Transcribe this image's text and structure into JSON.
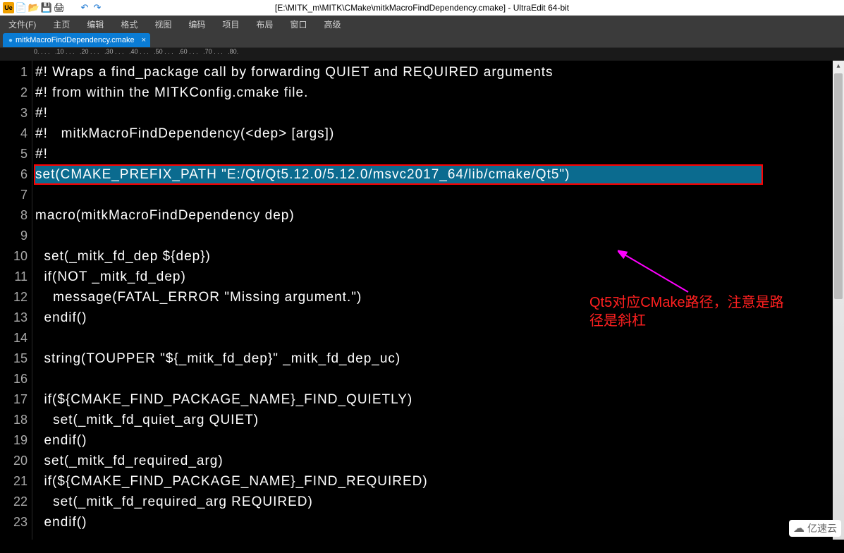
{
  "window": {
    "title": "[E:\\MITK_m\\MITK\\CMake\\mitkMacroFindDependency.cmake] - UltraEdit 64-bit"
  },
  "toolbar_icons": {
    "app": "UE",
    "new": "new-file",
    "open": "open-file",
    "save": "save",
    "print": "print",
    "undo": "undo",
    "redo": "redo"
  },
  "menu": {
    "file": "文件(F)",
    "home": "主页",
    "edit": "编辑",
    "format": "格式",
    "view": "视图",
    "coding": "编码",
    "project": "项目",
    "layout": "布局",
    "window": "窗口",
    "advanced": "高级"
  },
  "tab": {
    "label": "mitkMacroFindDependency.cmake",
    "close": "×",
    "modified_dot": "●"
  },
  "ruler_marks": "0. . . .   .10 . . .   .20 . . .   .30 . . .   .40 . . .   .50 . . .   .60 . . .   .70 . . .   .80.",
  "lines": [
    {
      "n": "1",
      "t": "#! Wraps a find_package call by forwarding QUIET and REQUIRED arguments"
    },
    {
      "n": "2",
      "t": "#! from within the MITKConfig.cmake file."
    },
    {
      "n": "3",
      "t": "#!"
    },
    {
      "n": "4",
      "t": "#!   mitkMacroFindDependency(<dep> [args])"
    },
    {
      "n": "5",
      "t": "#!"
    },
    {
      "n": "6",
      "t": "set(CMAKE_PREFIX_PATH \"E:/Qt/Qt5.12.0/5.12.0/msvc2017_64/lib/cmake/Qt5\")",
      "hl": true
    },
    {
      "n": "7",
      "t": "macro(mitkMacroFindDependency dep)"
    },
    {
      "n": "8",
      "t": ""
    },
    {
      "n": "9",
      "t": "  set(_mitk_fd_dep ${dep})"
    },
    {
      "n": "10",
      "t": "  if(NOT _mitk_fd_dep)"
    },
    {
      "n": "11",
      "t": "    message(FATAL_ERROR \"Missing argument.\")"
    },
    {
      "n": "12",
      "t": "  endif()"
    },
    {
      "n": "13",
      "t": ""
    },
    {
      "n": "14",
      "t": "  string(TOUPPER \"${_mitk_fd_dep}\" _mitk_fd_dep_uc)"
    },
    {
      "n": "15",
      "t": ""
    },
    {
      "n": "16",
      "t": "  if(${CMAKE_FIND_PACKAGE_NAME}_FIND_QUIETLY)"
    },
    {
      "n": "17",
      "t": "    set(_mitk_fd_quiet_arg QUIET)"
    },
    {
      "n": "18",
      "t": "  endif()"
    },
    {
      "n": "19",
      "t": "  set(_mitk_fd_required_arg)"
    },
    {
      "n": "20",
      "t": "  if(${CMAKE_FIND_PACKAGE_NAME}_FIND_REQUIRED)"
    },
    {
      "n": "21",
      "t": "    set(_mitk_fd_required_arg REQUIRED)"
    },
    {
      "n": "22",
      "t": "  endif()"
    },
    {
      "n": "23",
      "t": ""
    }
  ],
  "annotation": {
    "line1": "Qt5对应CMake路径，注意是路",
    "line2": "径是斜杠"
  },
  "watermark": {
    "cloud": "☁",
    "text": "亿速云"
  }
}
